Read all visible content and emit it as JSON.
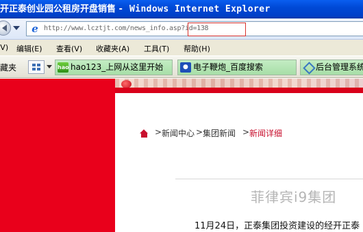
{
  "window": {
    "title_cn": "开正泰创业园公租房开盘销售 -",
    "title_en": "Windows Internet Explorer"
  },
  "address": {
    "url": "http://www.lcztjt.com/news_info.asp?id=138"
  },
  "menu": {
    "items": [
      "(V)",
      "编辑(E)",
      "查看(V)",
      "收藏夹(A)",
      "工具(T)",
      "帮助(H)"
    ]
  },
  "favorites": {
    "label": "藏夹",
    "tabs": [
      {
        "label": "hao123_上网从这里开始",
        "icon": "hao123-icon"
      },
      {
        "label": "电子鞭炮_百度搜索",
        "icon": "baidu-paw-icon"
      },
      {
        "label": "后台管理系统",
        "icon": "admin-icon"
      }
    ]
  },
  "page": {
    "breadcrumb": {
      "sep": ">",
      "items": [
        "新闻中心",
        "集团新闻",
        "新闻详细"
      ]
    },
    "watermark": "菲律宾i9集团",
    "body_text": "11月24日，正泰集团投资建设的经开正泰"
  },
  "colors": {
    "accent_red": "#e9001b",
    "title_blue": "#0049d6",
    "current_crumb": "#c8102e",
    "tab_green": "#b5e4b5"
  }
}
